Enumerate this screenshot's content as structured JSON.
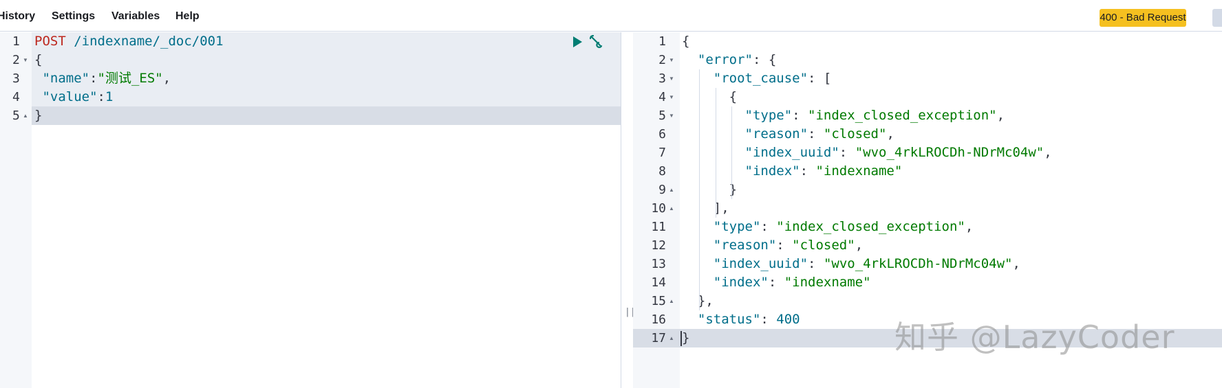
{
  "menu": {
    "history": "History",
    "settings": "Settings",
    "variables": "Variables",
    "help": "Help"
  },
  "status_badge": "400 - Bad Request",
  "request": {
    "line_numbers": [
      "1",
      "2",
      "3",
      "4",
      "5"
    ],
    "method": "POST",
    "url": " /indexname/_doc/001",
    "body": {
      "open": "{",
      "name_key": " \"name\"",
      "name_colon": ":",
      "name_value": "\"测试_ES\"",
      "name_comma": ",",
      "value_key": " \"value\"",
      "value_colon": ":",
      "value_value": "1",
      "close": "}"
    }
  },
  "response": {
    "line_numbers": [
      "1",
      "2",
      "3",
      "4",
      "5",
      "6",
      "7",
      "8",
      "9",
      "10",
      "11",
      "12",
      "13",
      "14",
      "15",
      "16",
      "17"
    ],
    "lines": [
      {
        "indent": "",
        "key": "",
        "sep": "{",
        "value": "",
        "tail": ""
      },
      {
        "indent": "  ",
        "key": "\"error\"",
        "sep": ": {",
        "value": "",
        "tail": ""
      },
      {
        "indent": "    ",
        "key": "\"root_cause\"",
        "sep": ": [",
        "value": "",
        "tail": ""
      },
      {
        "indent": "      ",
        "key": "",
        "sep": "{",
        "value": "",
        "tail": ""
      },
      {
        "indent": "        ",
        "key": "\"type\"",
        "sep": ": ",
        "value": "\"index_closed_exception\"",
        "tail": ","
      },
      {
        "indent": "        ",
        "key": "\"reason\"",
        "sep": ": ",
        "value": "\"closed\"",
        "tail": ","
      },
      {
        "indent": "        ",
        "key": "\"index_uuid\"",
        "sep": ": ",
        "value": "\"wvo_4rkLROCDh-NDrMc04w\"",
        "tail": ","
      },
      {
        "indent": "        ",
        "key": "\"index\"",
        "sep": ": ",
        "value": "\"indexname\"",
        "tail": ""
      },
      {
        "indent": "      ",
        "key": "",
        "sep": "}",
        "value": "",
        "tail": ""
      },
      {
        "indent": "    ",
        "key": "",
        "sep": "],",
        "value": "",
        "tail": ""
      },
      {
        "indent": "    ",
        "key": "\"type\"",
        "sep": ": ",
        "value": "\"index_closed_exception\"",
        "tail": ","
      },
      {
        "indent": "    ",
        "key": "\"reason\"",
        "sep": ": ",
        "value": "\"closed\"",
        "tail": ","
      },
      {
        "indent": "    ",
        "key": "\"index_uuid\"",
        "sep": ": ",
        "value": "\"wvo_4rkLROCDh-NDrMc04w\"",
        "tail": ","
      },
      {
        "indent": "    ",
        "key": "\"index\"",
        "sep": ": ",
        "value": "\"indexname\"",
        "tail": ""
      },
      {
        "indent": "  ",
        "key": "",
        "sep": "},",
        "value": "",
        "tail": ""
      },
      {
        "indent": "  ",
        "key": "\"status\"",
        "sep": ": ",
        "value": "400",
        "tail": ""
      },
      {
        "indent": "",
        "key": "",
        "sep": "}",
        "value": "",
        "tail": ""
      }
    ]
  },
  "divider_grip": "||",
  "watermark": "知乎 @LazyCoder",
  "icons": {
    "run": "play-icon",
    "settings": "wrench-icon",
    "fold": "fold-toggle-icon"
  },
  "colors": {
    "status_badge": "#f5c020",
    "method": "#bd271e",
    "key": "#006e8a",
    "string": "#007a00"
  }
}
